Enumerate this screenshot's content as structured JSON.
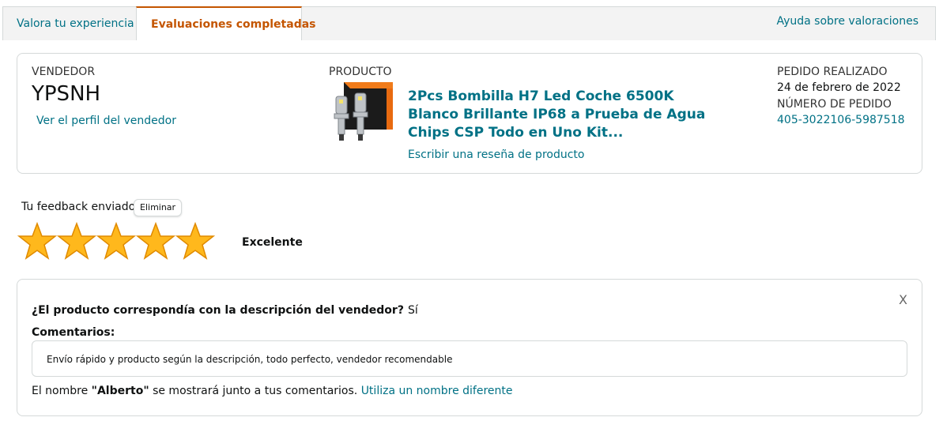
{
  "tabs": [
    {
      "label": "Valora tu experiencia"
    },
    {
      "label": "Evaluaciones completadas"
    }
  ],
  "help_link": "Ayuda sobre valoraciones",
  "seller": {
    "label": "VENDEDOR",
    "name": "YPSNH",
    "profile_link": "Ver el perfil del vendedor"
  },
  "product": {
    "label": "PRODUCTO",
    "title": "2Pcs Bombilla H7 Led Coche 6500K Blanco Brillante IP68 a Prueba de Agua Chips CSP Todo en Uno Kit...",
    "review_link": "Escribir una reseña de producto",
    "image_icon": "headlight-bulbs-product-image"
  },
  "order": {
    "placed_label": "PEDIDO REALIZADO",
    "date": "24 de febrero de 2022",
    "number_label": "NÚMERO DE PEDIDO",
    "number": "405-3022106-5987518"
  },
  "feedback": {
    "label": "Tu feedback enviado",
    "delete_label": "Eliminar",
    "rating": 5,
    "rating_max": 5,
    "rating_text": "Excelente"
  },
  "details": {
    "close_label": "X",
    "question": "¿El producto correspondía con la descripción del vendedor?",
    "answer": "Sí",
    "comments_label": "Comentarios:",
    "comment": "Envío rápido y producto según la descripción, todo perfecto, vendedor recomendable",
    "name_prefix": "El nombre ",
    "name": "\"Alberto\"",
    "name_suffix": " se mostrará junto a tus comentarios. ",
    "change_name_link": "Utiliza un nombre diferente"
  },
  "colors": {
    "link": "#007185",
    "active_tab": "#c45500",
    "star": "#ffa41c"
  }
}
